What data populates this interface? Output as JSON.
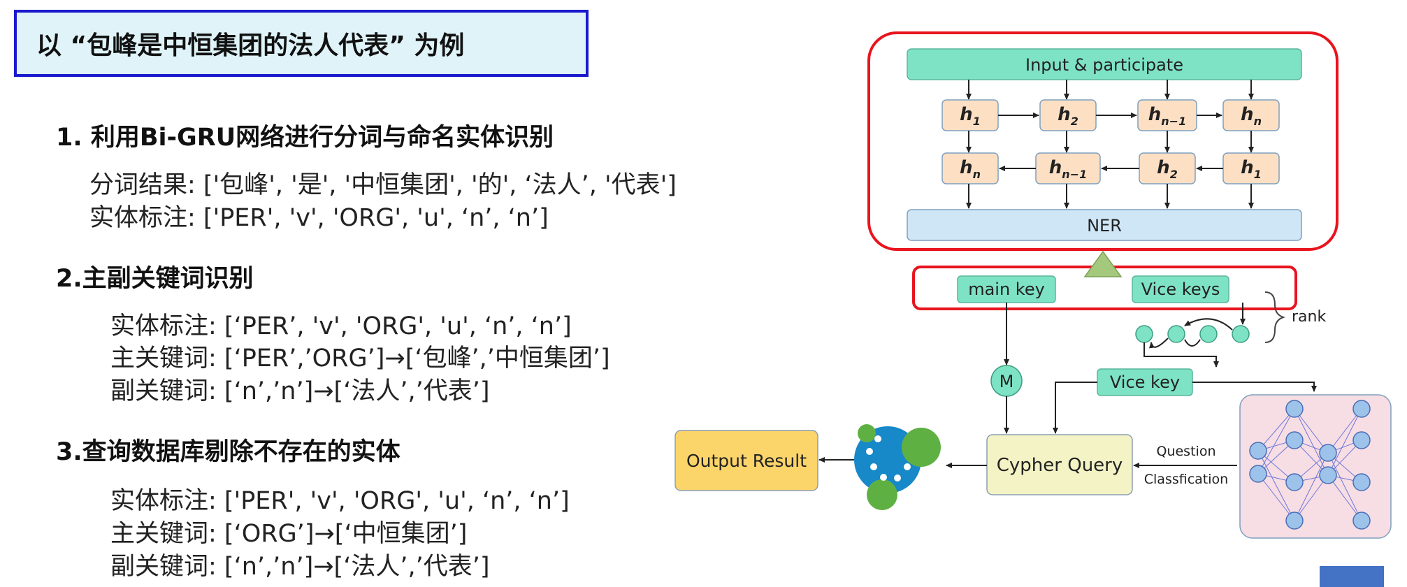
{
  "title": "以 “包峰是中恒集团的法人代表” 为例",
  "sections": [
    {
      "heading": "1. 利用Bi-GRU网络进行分词与命名实体识别",
      "lines": [
        "分词结果: ['包峰', '是', '中恒集团', '的', ‘法人’, '代表']",
        "实体标注: ['PER', 'v', 'ORG', 'u', ‘n’, ‘n’]"
      ]
    },
    {
      "heading": "2.主副关键词识别",
      "lines": [
        "实体标注: [‘PER’, 'v', 'ORG', 'u', ‘n’, ‘n’]",
        "主关键词: [‘PER’,’ORG’]→[‘包峰’,’中恒集团’]",
        "副关键词: [‘n’,’n’]→[‘法人’,’代表’]"
      ]
    },
    {
      "heading": "3.查询数据库剔除不存在的实体",
      "lines": [
        "实体标注: ['PER', 'v', 'ORG', 'u', ‘n’, ‘n’]",
        "主关键词: [‘ORG’]→[‘中恒集团’]",
        "副关键词: [‘n’,’n’]→[‘法人’,’代表’]"
      ]
    }
  ],
  "diagram": {
    "input_label": "Input & participate",
    "h_top": [
      {
        "base": "h",
        "sub": "1"
      },
      {
        "base": "h",
        "sub": "2"
      },
      {
        "base": "h",
        "sub": "n−1"
      },
      {
        "base": "h",
        "sub": "n"
      }
    ],
    "h_bottom": [
      {
        "base": "h",
        "sub": "n"
      },
      {
        "base": "h",
        "sub": "n−1"
      },
      {
        "base": "h",
        "sub": "2"
      },
      {
        "base": "h",
        "sub": "1"
      }
    ],
    "ner_label": "NER",
    "main_key_label": "main key",
    "vice_keys_label": "Vice keys",
    "rank_label": "rank",
    "m_label": "M",
    "vice_key_label": "Vice key",
    "cypher_label": "Cypher Query",
    "question_label": "Question",
    "classification_label": "Classfication",
    "output_label": "Output Result",
    "neo4j_logo": "neo4j-logo-icon",
    "neural_net_icon": "neural-network-icon"
  },
  "colors": {
    "title_border": "#1a1acc",
    "title_bg": "#dff3f8",
    "highlight_red": "#e8141e",
    "green_box": "#7ee3c4",
    "orange_box": "#fde0c4",
    "blue_box": "#cfe6f7",
    "yellow_box": "#fbd46a",
    "cream_box": "#f4f3c5",
    "pink_panel": "#f7dde4"
  }
}
